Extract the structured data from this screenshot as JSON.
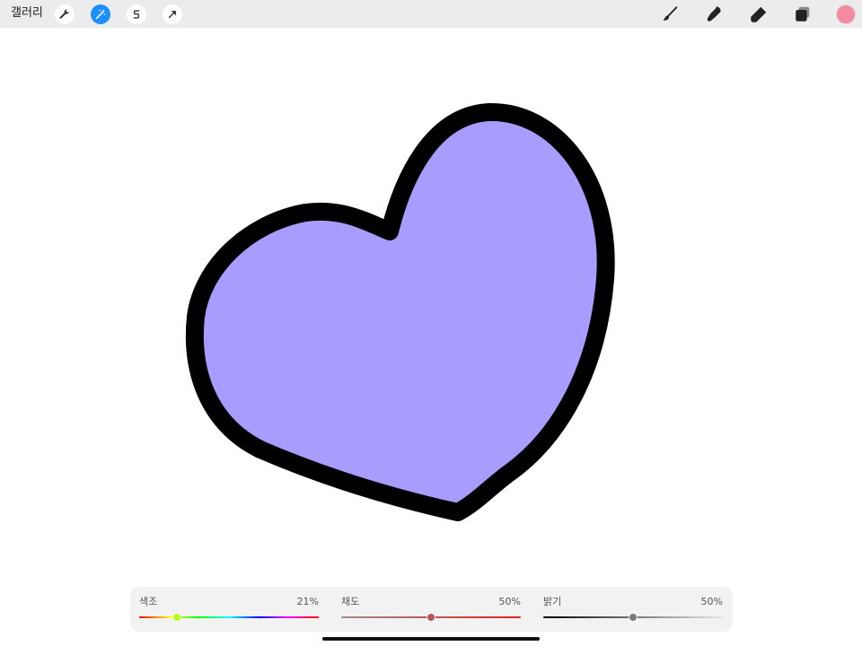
{
  "toolbar": {
    "gallery_label": "갤러리",
    "left_tools": [
      {
        "icon": "wrench-icon",
        "name": "actions"
      },
      {
        "icon": "magic-wand-icon",
        "name": "adjustments",
        "active": true
      },
      {
        "icon": "selection-s-icon",
        "name": "selection"
      },
      {
        "icon": "transform-arrow-icon",
        "name": "transform"
      }
    ],
    "right_tools": [
      {
        "icon": "brush-icon",
        "name": "paint"
      },
      {
        "icon": "smudge-icon",
        "name": "smudge"
      },
      {
        "icon": "eraser-icon",
        "name": "erase"
      },
      {
        "icon": "layers-icon",
        "name": "layers"
      }
    ],
    "current_color": "#f58aa0",
    "active_tool_color": "#1e8fff"
  },
  "canvas": {
    "shape": "heart",
    "fill_color": "#a99cff",
    "stroke_color": "#000000"
  },
  "sliders": {
    "hue": {
      "label": "색조",
      "value_text": "21%",
      "value": 0.21,
      "knob_color": "#b8ff1a"
    },
    "saturation": {
      "label": "채도",
      "value_text": "50%",
      "value": 0.5,
      "knob_color": "#b05a5a"
    },
    "brightness": {
      "label": "밝기",
      "value_text": "50%",
      "value": 0.5,
      "knob_color": "#7a7a7a"
    }
  }
}
